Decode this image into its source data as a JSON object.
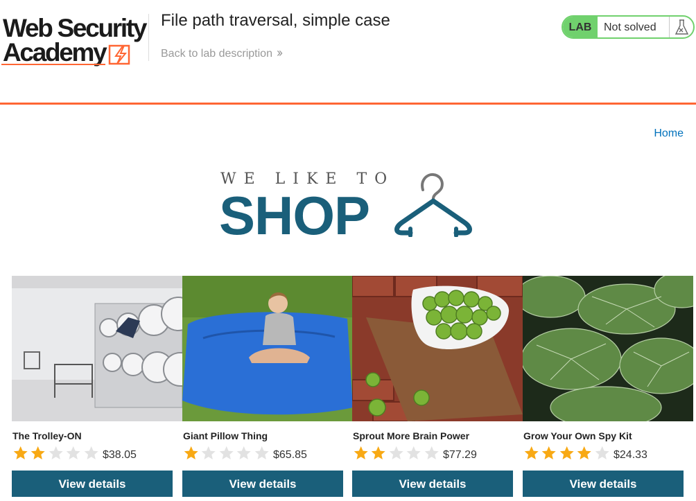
{
  "header": {
    "logo_line1": "Web Security",
    "logo_line2": "Academy",
    "lab_title": "File path traversal, simple case",
    "back_link": "Back to lab description",
    "status_badge": "LAB",
    "status_text": "Not solved"
  },
  "nav": {
    "home": "Home"
  },
  "banner": {
    "top": "WE LIKE TO",
    "main": "SHOP"
  },
  "colors": {
    "accent_orange": "#ff6633",
    "brand_blue": "#1a5f7a",
    "status_green": "#70d16d",
    "star_gold": "#f8a914",
    "link_blue": "#0071bc"
  },
  "products": [
    {
      "name": "The Trolley-ON",
      "price": "$38.05",
      "rating": 2,
      "button": "View details"
    },
    {
      "name": "Giant Pillow Thing",
      "price": "$65.85",
      "rating": 1,
      "button": "View details"
    },
    {
      "name": "Sprout More Brain Power",
      "price": "$77.29",
      "rating": 2,
      "button": "View details"
    },
    {
      "name": "Grow Your Own Spy Kit",
      "price": "$24.33",
      "rating": 4,
      "button": "View details"
    }
  ],
  "icons": [
    "lightning-bolt-icon",
    "double-chevron-right-icon",
    "flask-icon",
    "hanger-icon",
    "star-icon"
  ]
}
